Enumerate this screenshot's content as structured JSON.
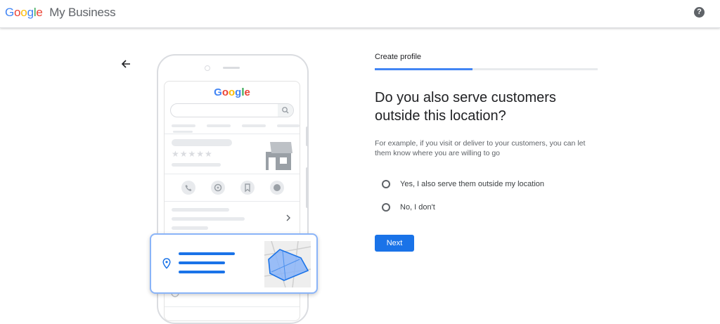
{
  "header": {
    "brand_letters": [
      {
        "char": "G",
        "color": "#4285F4"
      },
      {
        "char": "o",
        "color": "#EA4335"
      },
      {
        "char": "o",
        "color": "#FBBC05"
      },
      {
        "char": "g",
        "color": "#4285F4"
      },
      {
        "char": "l",
        "color": "#34A853"
      },
      {
        "char": "e",
        "color": "#EA4335"
      }
    ],
    "product": "My Business",
    "help_icon": "help-circle-icon",
    "help_glyph": "?"
  },
  "illustration": {
    "logo_text": "Google",
    "back_icon": "arrow-left-icon"
  },
  "form": {
    "step_label": "Create profile",
    "progress": 0.44,
    "heading": "Do you also serve customers outside this location?",
    "description": "For example, if you visit or deliver to your customers, you can let them know where you are willing to go",
    "options": [
      {
        "label": "Yes, I also serve them outside my location",
        "selected": false
      },
      {
        "label": "No, I don't",
        "selected": false
      }
    ],
    "next_label": "Next"
  },
  "colors": {
    "accent": "#1a73e8",
    "progress_track": "#e8eaed"
  }
}
